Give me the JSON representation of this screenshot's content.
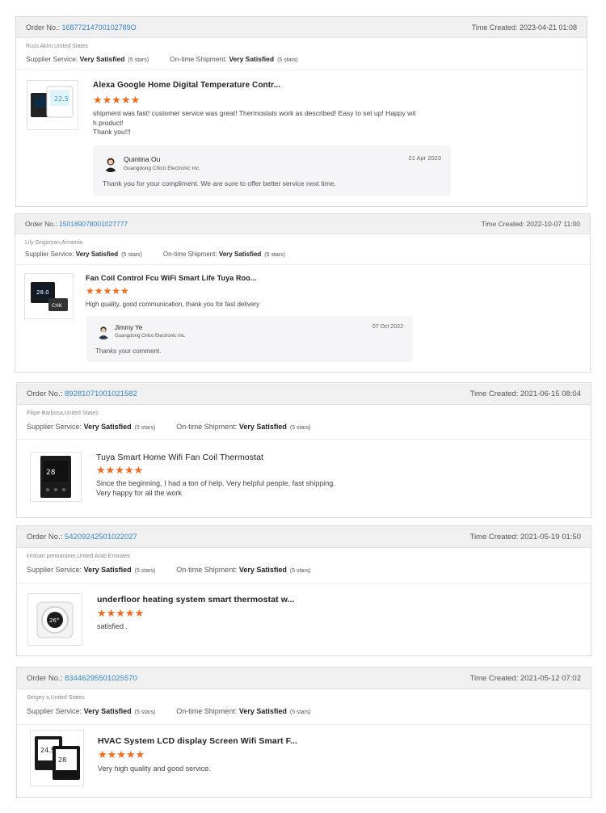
{
  "labels": {
    "order_no": "Order No.:",
    "time_created": "Time Created:",
    "supplier_service": "Supplier Service:",
    "ontime_shipment": "On-time Shipment:"
  },
  "reviews": [
    {
      "order_no": "16877214700102789O",
      "time_created": "2023-04-21 01:08",
      "buyer": "Russ Akim,United States",
      "supplier_rating": "Very Satisfied",
      "supplier_stars": "(5 stars)",
      "shipment_rating": "Very Satisfied",
      "shipment_stars": "(5 stars)",
      "product_title": "Alexa Google Home Digital Temperature Contr...",
      "stars": "★★★★★",
      "review_lines": [
        "shipment was fast! customer service was great! Thermostats work as described! Easy  to set up! Happy wit",
        "h product!",
        "Thank you!!!"
      ],
      "reply": {
        "name": "Quintina Ou",
        "company": "Guangdong Chico Electronic Inc.",
        "date": "21 Apr 2023",
        "text": "Thank you for your compliment. We are sure to offer better service next time."
      }
    },
    {
      "order_no": "150189078001027777",
      "time_created": "2022-10-07 11:00",
      "buyer": "Lily Grigoryan,Armenia",
      "supplier_rating": "Very Satisfied",
      "supplier_stars": "(5 stars)",
      "shipment_rating": "Very Satisfied",
      "shipment_stars": "(5 stars)",
      "product_title": "Fan Coil Control Fcu WiFi Smart Life Tuya Roo...",
      "stars": "★★★★★",
      "review_lines": [
        "High quality, good communication, thank you for fast delivery"
      ],
      "reply": {
        "name": "Jimmy Ye",
        "company": "Guangdong Chico Electronic Inc.",
        "date": "07 Oct 2022",
        "text": "Thanks your comment."
      }
    },
    {
      "order_no": "89281071001021582",
      "time_created": "2021-06-15 08:04",
      "buyer": "Filipe Barbosa,United States",
      "supplier_rating": "Very Satisfied",
      "supplier_stars": "(5 stars)",
      "shipment_rating": "Very Satisfied",
      "shipment_stars": "(5 stars)",
      "product_title": "Tuya Smart Home Wifi Fan Coil Thermostat",
      "stars": "★★★★★",
      "review_lines": [
        "Since the beginning, I had a ton of help. Very helpful people, fast shipping.",
        "Very happy for all the work"
      ]
    },
    {
      "order_no": "54209242501022027",
      "time_created": "2021-05-19 01:50",
      "buyer": "krishan premaratne,United Arab Emirates",
      "supplier_rating": "Very Satisfied",
      "supplier_stars": "(5 stars)",
      "shipment_rating": "Very Satisfied",
      "shipment_stars": "(5 stars)",
      "product_title": "underfloor heating system smart thermostat w...",
      "stars": "★★★★★",
      "review_lines": [
        "satisfied ."
      ]
    },
    {
      "order_no": "83446295501025570",
      "time_created": "2021-05-12 07:02",
      "buyer": "Sergey s,United States",
      "supplier_rating": "Very Satisfied",
      "supplier_stars": "(5 stars)",
      "shipment_rating": "Very Satisfied",
      "shipment_stars": "(5 stars)",
      "product_title": "HVAC System LCD display Screen Wifi Smart F...",
      "stars": "★★★★★",
      "review_lines": [
        "Very high quality and good service."
      ]
    }
  ],
  "colors": {
    "link": "#3a86c8",
    "star": "#f26b1d",
    "header_bg": "#f0f0f0",
    "reply_bg": "#f5f5f7"
  }
}
